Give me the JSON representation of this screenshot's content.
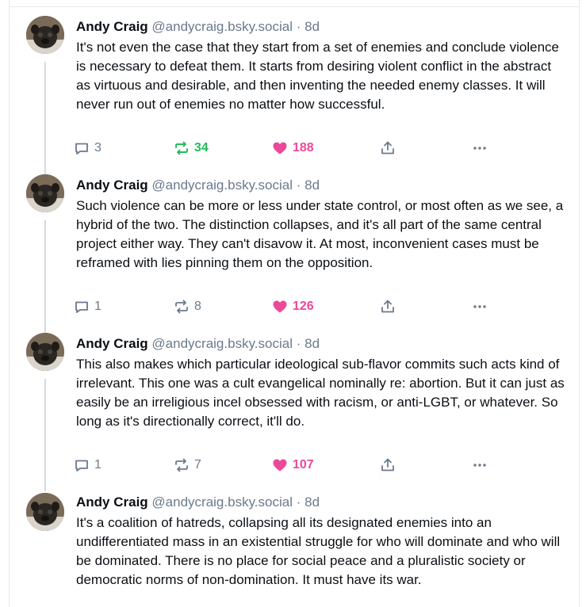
{
  "colors": {
    "text": "#0b0f14",
    "muted": "#6b7a8c",
    "repost_active": "#20bc5a",
    "like_active": "#ec4899",
    "divider": "#e5e9ee"
  },
  "posts": [
    {
      "author": {
        "name": "Andy Craig",
        "handle": "@andycraig.bsky.social",
        "avatar": "pug-avatar"
      },
      "separator": "·",
      "time": "8d",
      "text": "It's not even the case that they start from a set of enemies and conclude violence is necessary to defeat them. It starts from desiring violent conflict in the abstract as virtuous and desirable, and then inventing the needed enemy classes. It will never run out of enemies no matter how successful.",
      "replies": "3",
      "reposts": "34",
      "likes": "188",
      "reposted": true,
      "liked": true
    },
    {
      "author": {
        "name": "Andy Craig",
        "handle": "@andycraig.bsky.social",
        "avatar": "pug-avatar"
      },
      "separator": "·",
      "time": "8d",
      "text": "Such violence can be more or less under state control, or most often as we see, a hybrid of the two. The distinction collapses, and it's all part of the same central project either way. They can't disavow it. At most, inconvenient cases must be reframed with lies pinning them on the opposition.",
      "replies": "1",
      "reposts": "8",
      "likes": "126",
      "reposted": false,
      "liked": true
    },
    {
      "author": {
        "name": "Andy Craig",
        "handle": "@andycraig.bsky.social",
        "avatar": "pug-avatar"
      },
      "separator": "·",
      "time": "8d",
      "text": "This also makes which particular ideological sub-flavor commits such acts kind of irrelevant. This one was a cult evangelical nominally re: abortion. But it can just as easily be an irreligious incel obsessed with racism, or anti-LGBT, or whatever. So long as it's directionally correct, it'll do.",
      "replies": "1",
      "reposts": "7",
      "likes": "107",
      "reposted": false,
      "liked": true
    },
    {
      "author": {
        "name": "Andy Craig",
        "handle": "@andycraig.bsky.social",
        "avatar": "pug-avatar"
      },
      "separator": "·",
      "time": "8d",
      "text": "It's a coalition of hatreds, collapsing all its designated enemies into an undifferentiated mass in an existential struggle for who will dominate and who will be dominated. There is no place for social peace and a pluralistic society or democratic norms of non-domination. It must have its war."
    }
  ],
  "icons": {
    "reply": "speech-bubble-icon",
    "repost": "repost-arrows-icon",
    "like": "heart-icon",
    "share": "share-icon",
    "more": "ellipsis-icon"
  }
}
